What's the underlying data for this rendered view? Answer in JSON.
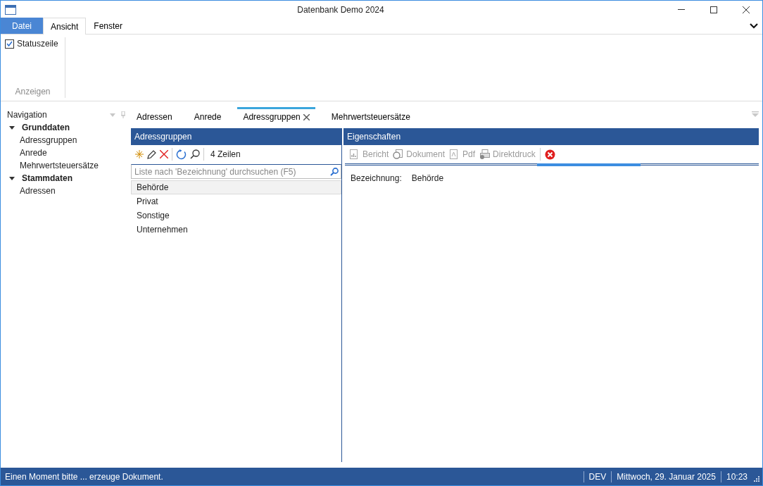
{
  "window": {
    "title": "Datenbank Demo 2024"
  },
  "ribbon": {
    "tabs": [
      {
        "label": "Datei",
        "kind": "file",
        "selected": false
      },
      {
        "label": "Ansicht",
        "kind": "tab",
        "selected": true
      },
      {
        "label": "Fenster",
        "kind": "tab",
        "selected": false
      }
    ],
    "groups": [
      {
        "label": "Anzeigen",
        "items": [
          {
            "label": "Statuszeile",
            "checked": true
          }
        ]
      }
    ]
  },
  "navigation": {
    "title": "Navigation",
    "items": [
      {
        "label": "Grunddaten",
        "expanded": true,
        "children": [
          {
            "label": "Adressgruppen"
          },
          {
            "label": "Anrede"
          },
          {
            "label": "Mehrwertsteuersätze"
          }
        ]
      },
      {
        "label": "Stammdaten",
        "expanded": true,
        "children": [
          {
            "label": "Adressen"
          }
        ]
      }
    ]
  },
  "document_tabs": [
    {
      "label": "Adressen",
      "selected": false
    },
    {
      "label": "Anrede",
      "selected": false
    },
    {
      "label": "Adressgruppen",
      "selected": true
    },
    {
      "label": "Mehrwertsteuersätze",
      "selected": false
    }
  ],
  "list_panel": {
    "title": "Adressgruppen",
    "row_count": "4 Zeilen",
    "search": {
      "placeholder": "Liste nach 'Bezeichnung' durchsuchen (F5)"
    },
    "rows": [
      {
        "label": "Behörde",
        "selected": true
      },
      {
        "label": "Privat",
        "selected": false
      },
      {
        "label": "Sonstige",
        "selected": false
      },
      {
        "label": "Unternehmen",
        "selected": false
      }
    ]
  },
  "properties_panel": {
    "title": "Eigenschaften",
    "toolbar": [
      {
        "label": "Bericht",
        "kind": "report",
        "disabled": true
      },
      {
        "label": "Dokument",
        "kind": "document",
        "disabled": true
      },
      {
        "label": "Pdf",
        "kind": "pdf",
        "disabled": true
      },
      {
        "label": "Direktdruck",
        "kind": "print",
        "disabled": true
      }
    ],
    "fields": [
      {
        "label": "Bezeichnung:",
        "value": "Behörde"
      }
    ]
  },
  "status_bar": {
    "message": "Einen Moment bitte ... erzeuge Dokument.",
    "items": [
      "DEV",
      "Mittwoch, 29. Januar 2025",
      "10:23"
    ]
  }
}
